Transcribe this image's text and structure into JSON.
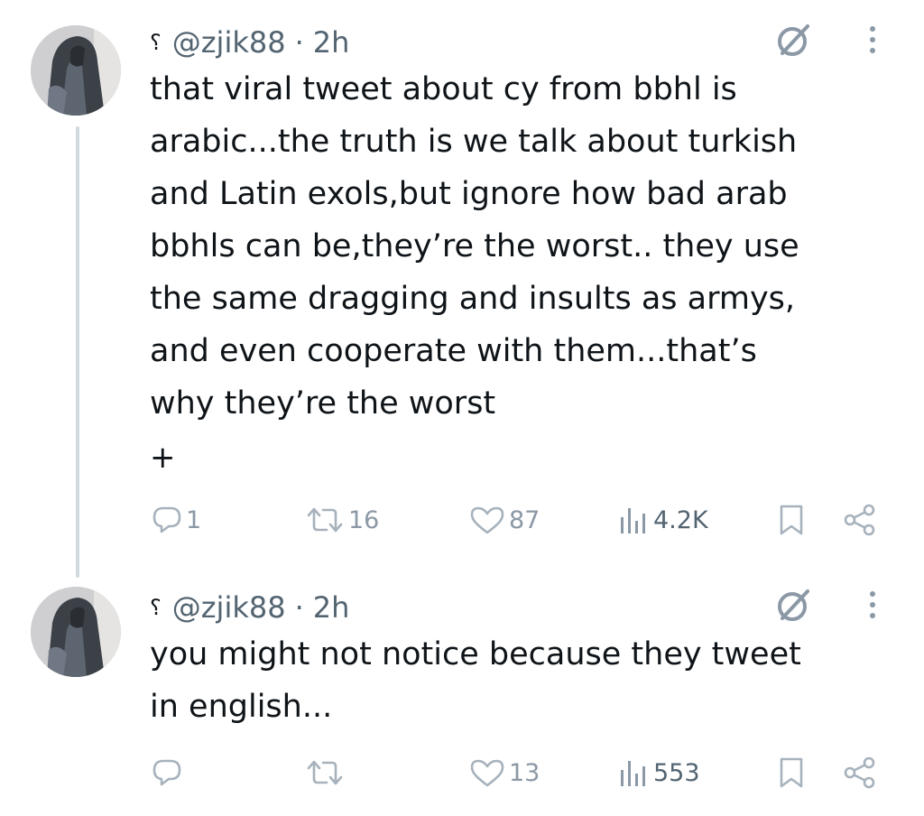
{
  "tweets": [
    {
      "handle": "@zjik88",
      "separator": "·",
      "time": "2h",
      "name_glyph": "؟",
      "text": "that viral tweet about cy from bbhl is\narabic...the truth is we talk about turkish\nand Latin exols,but ignore how bad arab\nbbhls can be,they’re the worst.. they use\nthe same dragging and insults as armys,\nand even cooperate with them...that’s\nwhy they’re the worst",
      "expand_label": "+",
      "replies": "1",
      "reposts": "16",
      "likes": "87",
      "views": "4.2K",
      "icons": [
        "grok-icon",
        "more-icon",
        "reply-icon",
        "repost-icon",
        "like-icon",
        "views-icon",
        "bookmark-icon",
        "share-icon"
      ]
    },
    {
      "handle": "@zjik88",
      "separator": "·",
      "time": "2h",
      "name_glyph": "؟",
      "text": "you might not notice because they tweet\nin english...",
      "replies": "",
      "reposts": "",
      "likes": "13",
      "views": "553",
      "icons": [
        "grok-icon",
        "more-icon",
        "reply-icon",
        "repost-icon",
        "like-icon",
        "views-icon",
        "bookmark-icon",
        "share-icon"
      ]
    }
  ],
  "colors": {
    "text": "#0f1419",
    "secondary": "#536471",
    "icon": "#8b98a5",
    "thread_line": "#cfd9de"
  }
}
